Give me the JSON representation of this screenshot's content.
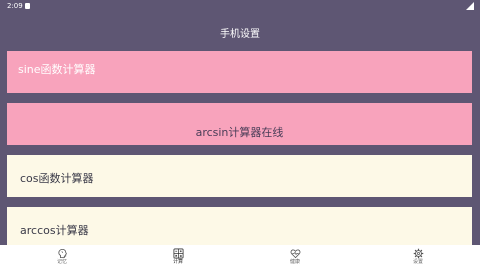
{
  "status": {
    "time": "2:09"
  },
  "header": {
    "title": "手机设置"
  },
  "cards": [
    {
      "label": "sine函数计算器"
    },
    {
      "label": "arcsin计算器在线"
    },
    {
      "label": "cos函数计算器"
    },
    {
      "label": "arccos计算器"
    }
  ],
  "nav": [
    {
      "label": "记忆",
      "icon": "brain-icon"
    },
    {
      "label": "计算",
      "icon": "calculator-icon"
    },
    {
      "label": "健康",
      "icon": "heart-pulse-icon"
    },
    {
      "label": "设置",
      "icon": "gear-icon"
    }
  ],
  "colors": {
    "background": "#5e5673",
    "pink": "#f8a3bc",
    "cream": "#fdf9e7"
  }
}
